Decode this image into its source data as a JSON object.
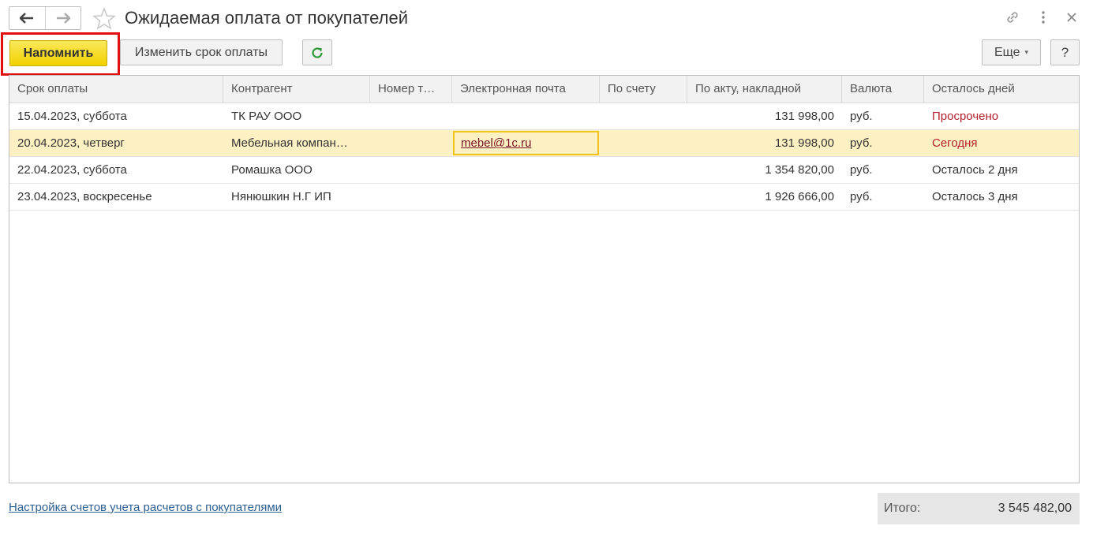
{
  "window": {
    "title": "Ожидаемая оплата от покупателей"
  },
  "toolbar": {
    "remind_label": "Напомнить",
    "change_due_label": "Изменить срок оплаты",
    "more_label": "Еще",
    "help_label": "?"
  },
  "table": {
    "columns": [
      "Срок оплаты",
      "Контрагент",
      "Номер т…",
      "Электронная почта",
      "По счету",
      "По акту, накладной",
      "Валюта",
      "Осталось дней"
    ],
    "rows": [
      {
        "due_date": "15.04.2023, суббота",
        "counterparty": "ТК РАУ ООО",
        "number": "",
        "email": "",
        "by_invoice": "",
        "by_act": "131 998,00",
        "currency": "руб.",
        "days_left": "Просрочено"
      },
      {
        "due_date": "20.04.2023, четверг",
        "counterparty": "Мебельная компан…",
        "number": "",
        "email": "mebel@1c.ru",
        "by_invoice": "",
        "by_act": "131 998,00",
        "currency": "руб.",
        "days_left": "Сегодня"
      },
      {
        "due_date": "22.04.2023, суббота",
        "counterparty": "Ромашка ООО",
        "number": "",
        "email": "",
        "by_invoice": "",
        "by_act": "1 354 820,00",
        "currency": "руб.",
        "days_left": "Осталось 2 дня"
      },
      {
        "due_date": "23.04.2023, воскресенье",
        "counterparty": "Нянюшкин Н.Г ИП",
        "number": "",
        "email": "",
        "by_invoice": "",
        "by_act": "1 926 666,00",
        "currency": "руб.",
        "days_left": "Осталось 3 дня"
      }
    ]
  },
  "footer": {
    "settings_link": "Настройка счетов учета расчетов с покупателями",
    "total_label": "Итого:",
    "total_value": "3 545 482,00"
  },
  "colors": {
    "primary_button": "#f1d100",
    "highlight_frame": "#e30e0e",
    "selected_row": "#fdf0c2",
    "overdue_text": "#b21f2d",
    "link": "#2c5d8f"
  }
}
